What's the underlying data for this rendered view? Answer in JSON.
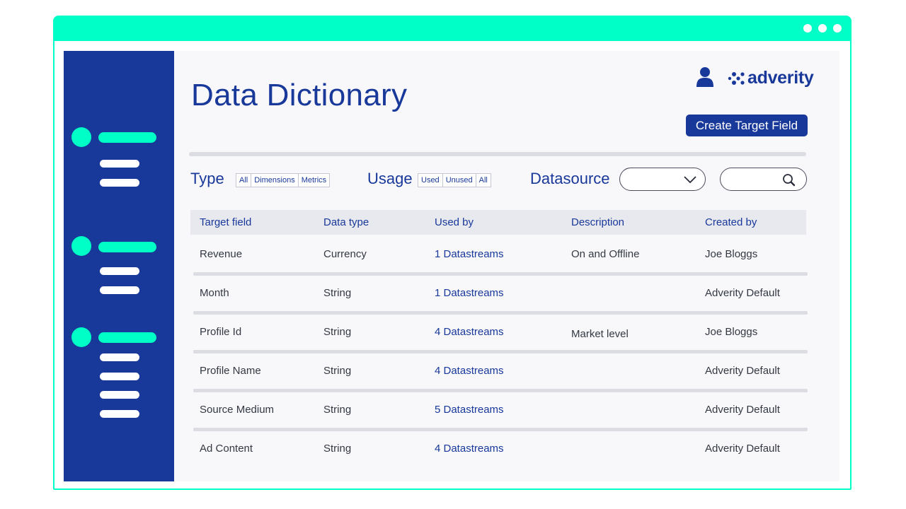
{
  "window": {
    "controls": [
      "dot",
      "dot",
      "dot"
    ]
  },
  "header": {
    "title": "Data Dictionary",
    "brand": "adverity",
    "create_button": "Create Target Field"
  },
  "filters": {
    "type": {
      "label": "Type",
      "options": [
        "All",
        "Dimensions",
        "Metrics"
      ]
    },
    "usage": {
      "label": "Usage",
      "options": [
        "Used",
        "Unused",
        "All"
      ]
    },
    "datasource": {
      "label": "Datasource",
      "value": ""
    },
    "search": {
      "value": ""
    }
  },
  "table": {
    "columns": [
      "Target field",
      "Data type",
      "Used by",
      "Description",
      "Created by"
    ],
    "rows": [
      {
        "target_field": "Revenue",
        "data_type": "Currency",
        "used_by": "1 Datastreams",
        "description": "On and Offline",
        "created_by": "Joe Bloggs"
      },
      {
        "target_field": "Month",
        "data_type": "String",
        "used_by": "1 Datastreams",
        "description": "",
        "created_by": "Adverity Default"
      },
      {
        "target_field": "Profile Id",
        "data_type": "String",
        "used_by": "4 Datastreams",
        "description": "Market level",
        "created_by": "Joe Bloggs"
      },
      {
        "target_field": "Profile Name",
        "data_type": "String",
        "used_by": "4 Datastreams",
        "description": "",
        "created_by": "Adverity Default"
      },
      {
        "target_field": "Source Medium",
        "data_type": "String",
        "used_by": "5 Datastreams",
        "description": "",
        "created_by": "Adverity Default"
      },
      {
        "target_field": "Ad Content",
        "data_type": "String",
        "used_by": "4 Datastreams",
        "description": "",
        "created_by": "Adverity Default"
      }
    ]
  },
  "colors": {
    "accent": "#00ffc6",
    "brand": "#18389a"
  }
}
